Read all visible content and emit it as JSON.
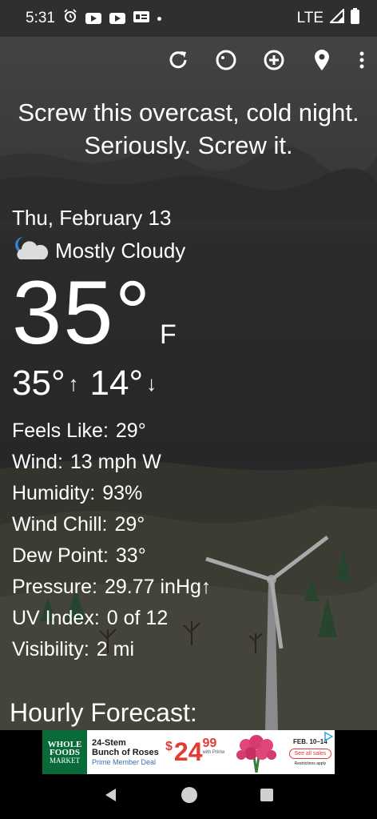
{
  "status_bar": {
    "time": "5:31",
    "network": "LTE",
    "icons": [
      "alarm-icon",
      "youtube-icon",
      "youtube-icon",
      "news-icon",
      "dot-icon",
      "signal-icon",
      "battery-icon"
    ]
  },
  "toolbar": {
    "icons": [
      "refresh-icon",
      "theme-icon",
      "add-location-icon",
      "location-pin-icon",
      "more-vert-icon"
    ]
  },
  "headline": "Screw this overcast, cold night. Seriously. Screw it.",
  "weather": {
    "date": "Thu, February 13",
    "condition": "Mostly Cloudy",
    "condition_icon": "moon-cloud-icon",
    "temperature": "35°",
    "unit": "F",
    "high": "35°",
    "high_arrow": "↑",
    "low": "14°",
    "low_arrow": "↓"
  },
  "details": [
    {
      "label": "Feels Like:",
      "value": "29°"
    },
    {
      "label": "Wind:",
      "value": "13 mph W"
    },
    {
      "label": "Humidity:",
      "value": "93%"
    },
    {
      "label": "Wind Chill:",
      "value": "29°"
    },
    {
      "label": "Dew Point:",
      "value": "33°"
    },
    {
      "label": "Pressure:",
      "value": "29.77 inHg↑"
    },
    {
      "label": "UV Index:",
      "value": "0 of 12"
    },
    {
      "label": "Visibility:",
      "value": "2 mi"
    }
  ],
  "hourly_title": "Hourly Forecast:",
  "ad": {
    "logo_line1": "WHOLE",
    "logo_line2": "FOODS",
    "logo_line3": "MARKET",
    "title1": "24-Stem",
    "title2": "Bunch of Roses",
    "subtitle": "Prime Member Deal",
    "price_symbol": "$",
    "price_whole": "24",
    "price_cents": "99",
    "price_note": "with Prime",
    "date_range": "FEB. 10–14",
    "button": "See all sales",
    "fine_print": "Restrictions apply"
  },
  "colors": {
    "ad_red": "#e23b33",
    "ad_green": "#0a6b3a"
  }
}
